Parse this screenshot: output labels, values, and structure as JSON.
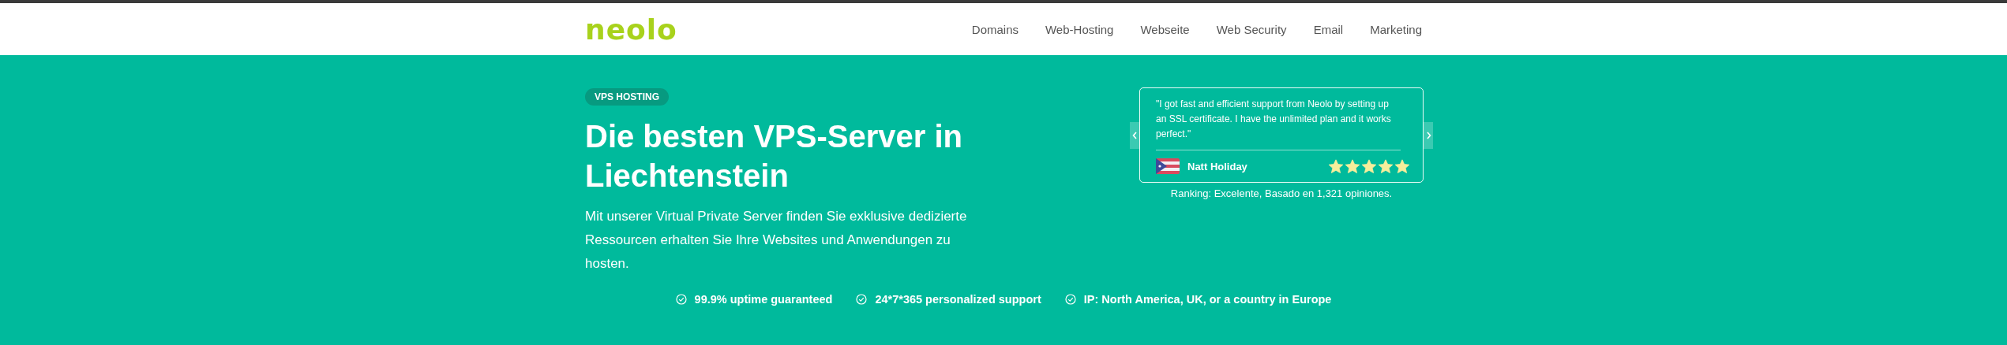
{
  "header": {
    "logo": "neolo",
    "nav": [
      "Domains",
      "Web-Hosting",
      "Webseite",
      "Web Security",
      "Email",
      "Marketing"
    ]
  },
  "hero": {
    "badge": "VPS HOSTING",
    "title": "Die besten VPS-Server in Liechtenstein",
    "text": "Mit unserer Virtual Private Server finden Sie exklusive dedizierte Ressourcen erhalten Sie Ihre Websites und Anwendungen zu hosten."
  },
  "testimonial": {
    "quote": "\"I got fast and efficient support from Neolo by setting up an SSL certificate. I have the unlimited plan and it works perfect.\"",
    "author": "Natt Holiday",
    "stars": 5,
    "ranking": "Ranking: Excelente, Basado en 1,321 opiniones."
  },
  "features": [
    "99.9% uptime guaranteed",
    "24*7*365 personalized support",
    "IP: North America, UK, or a country in Europe"
  ]
}
